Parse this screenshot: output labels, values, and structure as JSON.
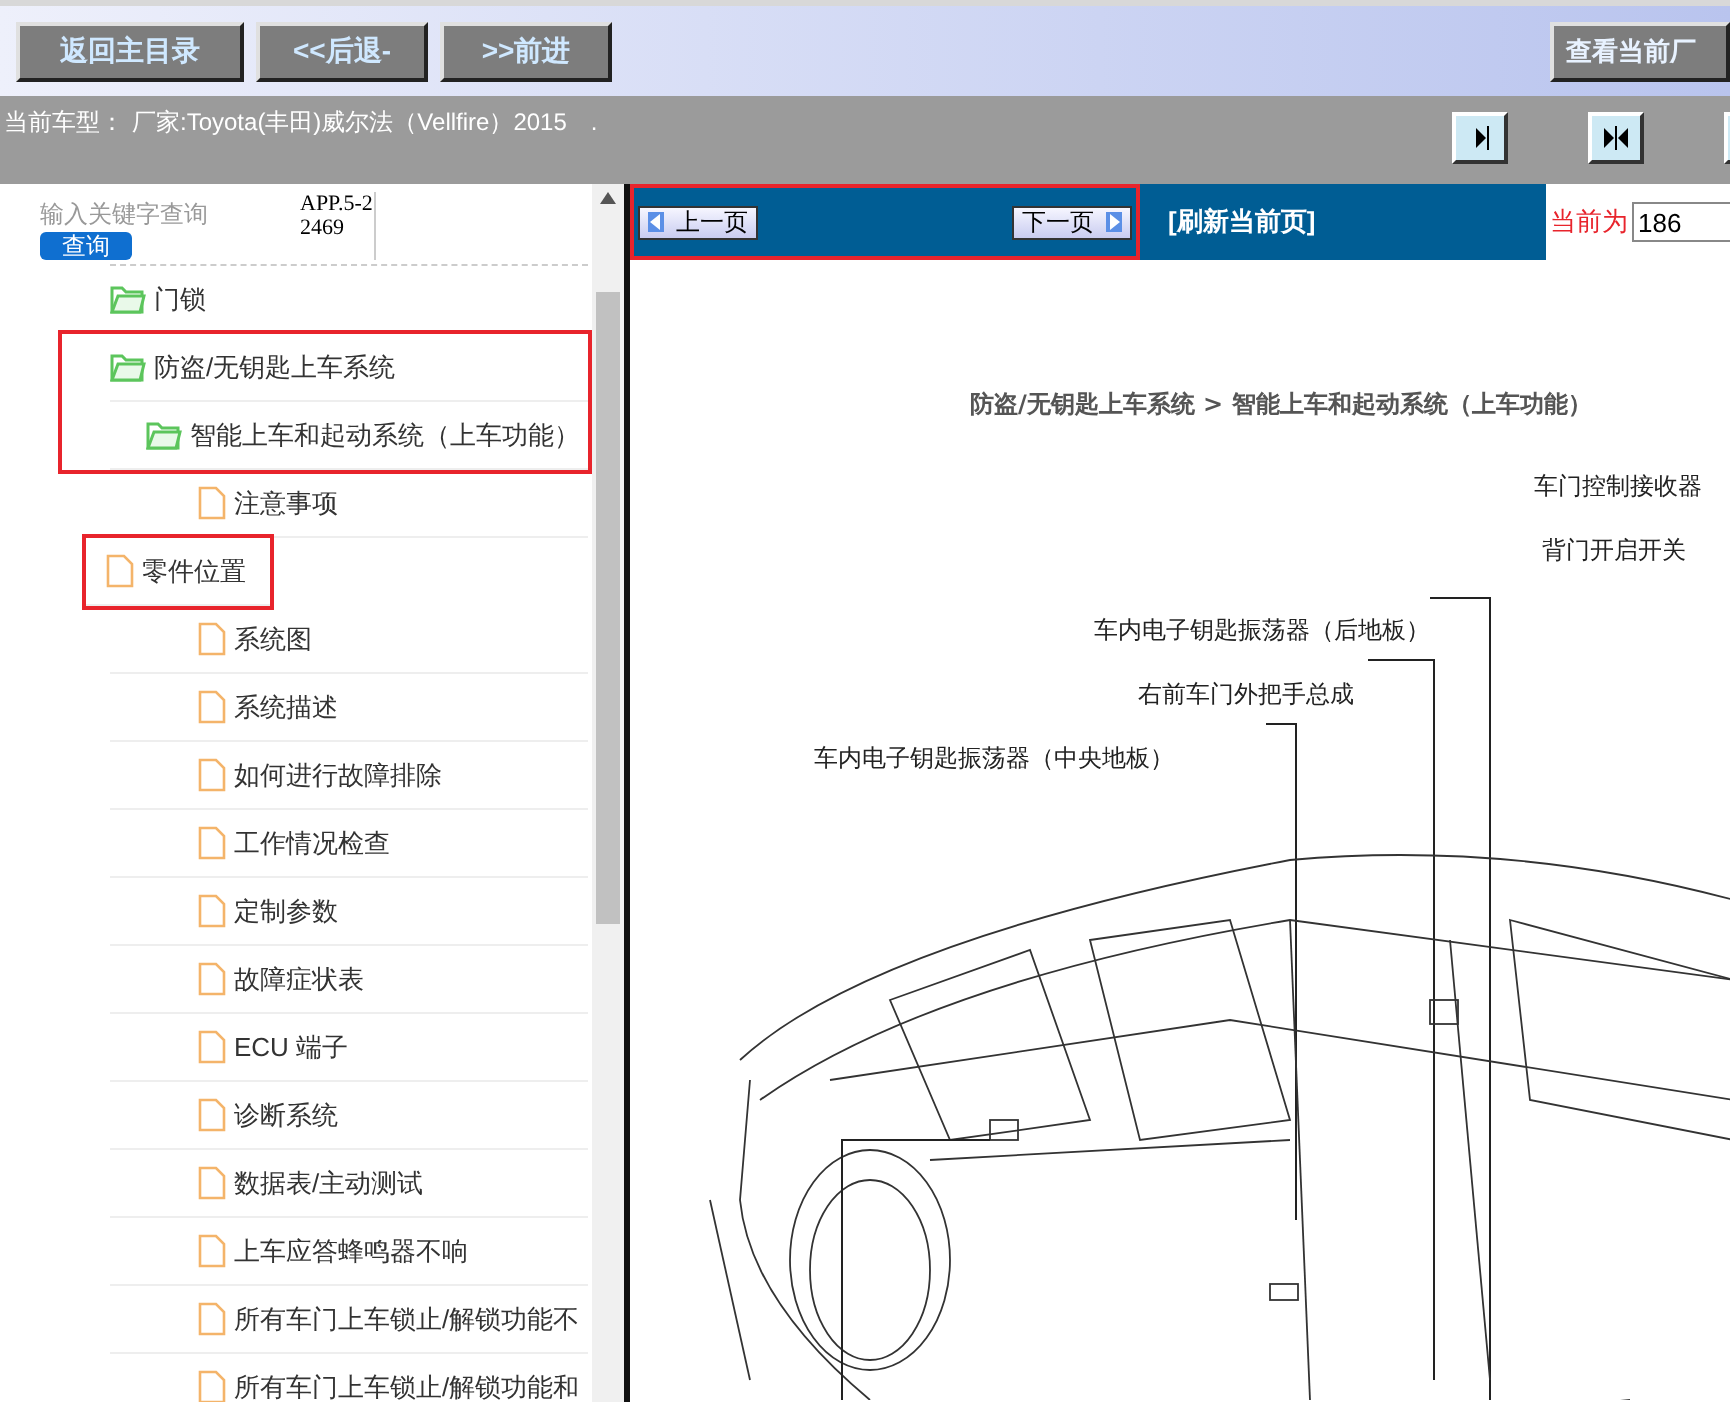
{
  "toolbar": {
    "buttons": [
      "返回主目录",
      "<<后退-",
      ">>前进"
    ],
    "right_button": "查看当前厂"
  },
  "vehicle_bar": {
    "label": "当前车型：",
    "vehicle": "厂家:Toyota(丰田)威尔法（Vellfire）2015",
    "dot": "."
  },
  "search": {
    "placeholder": "输入关键字查询",
    "button": "查询",
    "code": "APP.5-22469"
  },
  "tree": [
    {
      "label": "门锁",
      "kind": "folder",
      "highlighted": false
    },
    {
      "label": "防盗/无钥匙上车系统",
      "kind": "folder",
      "highlighted": true,
      "children": [
        {
          "label": "智能上车和起动系统（上车功能）",
          "kind": "folder",
          "highlighted": true,
          "children": [
            {
              "label": "注意事项",
              "kind": "doc",
              "highlighted": false
            },
            {
              "label": "零件位置",
              "kind": "doc",
              "highlighted": true
            },
            {
              "label": "系统图",
              "kind": "doc",
              "highlighted": false
            },
            {
              "label": "系统描述",
              "kind": "doc",
              "highlighted": false
            },
            {
              "label": "如何进行故障排除",
              "kind": "doc",
              "highlighted": false
            },
            {
              "label": "工作情况检查",
              "kind": "doc",
              "highlighted": false
            },
            {
              "label": "定制参数",
              "kind": "doc",
              "highlighted": false
            },
            {
              "label": "故障症状表",
              "kind": "doc",
              "highlighted": false
            },
            {
              "label": "ECU 端子",
              "kind": "doc",
              "highlighted": false
            },
            {
              "label": "诊断系统",
              "kind": "doc",
              "highlighted": false
            },
            {
              "label": "数据表/主动测试",
              "kind": "doc",
              "highlighted": false
            },
            {
              "label": "上车应答蜂鸣器不响",
              "kind": "doc",
              "highlighted": false
            },
            {
              "label": "所有车门上车锁止/解锁功能不",
              "kind": "doc",
              "highlighted": false
            },
            {
              "label": "所有车门上车锁止/解锁功能和",
              "kind": "doc",
              "highlighted": false
            }
          ]
        }
      ]
    }
  ],
  "pager": {
    "prev": "上一页",
    "next": "下一页",
    "highlighted": true,
    "refresh": "[刷新当前页]",
    "page_label": "当前为",
    "page_value": "186"
  },
  "document": {
    "title": "防盗/无钥匙上车系统 > 智能上车和起动系统（上车功能）",
    "callouts": [
      "车门控制接收器",
      "背门开启开关",
      "车内电子钥匙振荡器（后地板）",
      "右前车门外把手总成",
      "车内电子钥匙振荡器（中央地板）"
    ]
  }
}
